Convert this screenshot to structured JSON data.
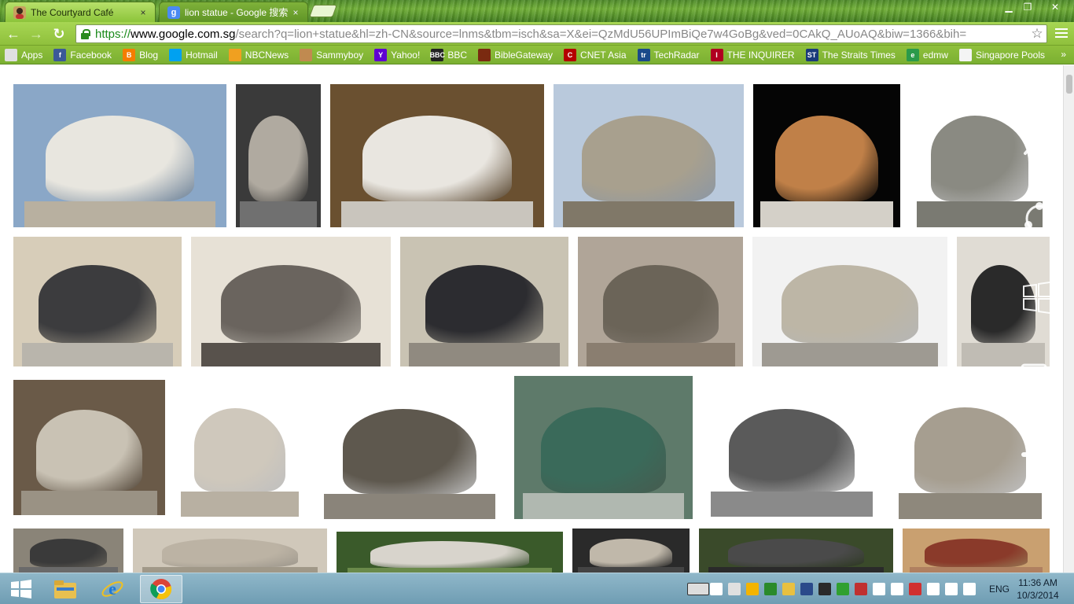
{
  "browser": {
    "tabs": [
      {
        "title": "The Courtyard Café",
        "active": true,
        "favicon": "avatar-icon",
        "close": "×"
      },
      {
        "title": "lion statue - Google 搜索",
        "active": false,
        "favicon": "google-icon",
        "favicon_text": "g",
        "close": "×"
      }
    ],
    "window_buttons": {
      "minimize": "▁",
      "maximize": "❐",
      "close": "✕"
    },
    "nav": {
      "back": "←",
      "forward": "→",
      "reload": "↻"
    },
    "url": {
      "scheme": "https://",
      "host": "www.google.com.sg",
      "rest": "/search?q=lion+statue&hl=zh-CN&source=lnms&tbm=isch&sa=X&ei=QzMdU56UPImBiQe7w4GoBg&ved=0CAkQ_AUoAQ&biw=1366&bih="
    },
    "star": "☆"
  },
  "bookmarks": [
    {
      "label": "Apps",
      "icon": "apps-grid-icon",
      "color": "#e0e0e0",
      "text": ""
    },
    {
      "label": "Facebook",
      "icon": "facebook-icon",
      "color": "#3b5998",
      "text": "f"
    },
    {
      "label": "Blog",
      "icon": "blogger-icon",
      "color": "#f57d00",
      "text": "B"
    },
    {
      "label": "Hotmail",
      "icon": "windows-flag-icon",
      "color": "#00a1f1",
      "text": ""
    },
    {
      "label": "NBCNews",
      "icon": "peacock-icon",
      "color": "#f0a020",
      "text": ""
    },
    {
      "label": "Sammyboy",
      "icon": "face-icon",
      "color": "#c08a50",
      "text": ""
    },
    {
      "label": "Yahoo!",
      "icon": "yahoo-icon",
      "color": "#5f01d1",
      "text": "Y"
    },
    {
      "label": "BBC",
      "icon": "bbc-icon",
      "color": "#222222",
      "text": "BBC"
    },
    {
      "label": "BibleGateway",
      "icon": "biblegateway-icon",
      "color": "#7a2a10",
      "text": ""
    },
    {
      "label": "CNET Asia",
      "icon": "cnet-icon",
      "color": "#b40000",
      "text": "C"
    },
    {
      "label": "TechRadar",
      "icon": "techradar-icon",
      "color": "#1a4a8a",
      "text": "tr"
    },
    {
      "label": "THE INQUIRER",
      "icon": "inquirer-icon",
      "color": "#b00020",
      "text": "I"
    },
    {
      "label": "The Straits Times",
      "icon": "straits-times-icon",
      "color": "#1a3a7a",
      "text": "ST"
    },
    {
      "label": "edmw",
      "icon": "edmw-icon",
      "color": "#2a9a4a",
      "text": "e"
    },
    {
      "label": "Singapore Pools",
      "icon": "page-icon",
      "color": "#f4f4f4",
      "text": ""
    }
  ],
  "bookmarks_overflow": "»",
  "images": [
    {
      "id": "r1c1",
      "sky": "#8aa7c7",
      "lion": "#e8e6df",
      "base": "#b8b0a0"
    },
    {
      "id": "r1c2",
      "sky": "#3a3a3a",
      "lion": "#b0aaa0",
      "base": "#707070"
    },
    {
      "id": "r1c3",
      "sky": "#6a5030",
      "lion": "#e9e6e0",
      "base": "#c9c5bd"
    },
    {
      "id": "r1c4",
      "sky": "#b9c9dc",
      "lion": "#a8a08e",
      "base": "#807868"
    },
    {
      "id": "r1c5",
      "sky": "#050505",
      "lion": "#c08048",
      "base": "#d4d0c8"
    },
    {
      "id": "r1c6",
      "sky": "#ffffff",
      "lion": "#8a8a82",
      "base": "#7a7a72"
    },
    {
      "id": "r2c1",
      "sky": "#d7cdb9",
      "lion": "#3c3c3e",
      "base": "#b9b5ac"
    },
    {
      "id": "r2c2",
      "sky": "#e7e1d6",
      "lion": "#6a645e",
      "base": "#58524c"
    },
    {
      "id": "r2c3",
      "sky": "#c9c3b3",
      "lion": "#2c2c30",
      "base": "#908a80"
    },
    {
      "id": "r2c4",
      "sky": "#b0a598",
      "lion": "#6b6458",
      "base": "#8a7e70"
    },
    {
      "id": "r2c5",
      "sky": "#f2f2f2",
      "lion": "#bdb6a6",
      "base": "#9e9a92"
    },
    {
      "id": "r2c6",
      "sky": "#e0dcd4",
      "lion": "#2a2a2a",
      "base": "#c0bcb4"
    },
    {
      "id": "r3c1",
      "sky": "#6a5a48",
      "lion": "#c9c2b4",
      "base": "#9a9284"
    },
    {
      "id": "r3c2",
      "sky": "#ffffff",
      "lion": "#cfc8bc",
      "base": "#b8b0a2"
    },
    {
      "id": "r3c3",
      "sky": "#ffffff",
      "lion": "#5e584e",
      "base": "#8a847a"
    },
    {
      "id": "r3c4",
      "sky": "#5e7a6a",
      "lion": "#3a6a5a",
      "base": "#b0b8b0"
    },
    {
      "id": "r3c5",
      "sky": "#ffffff",
      "lion": "#5a5a5a",
      "base": "#8a8a8a"
    },
    {
      "id": "r3c6",
      "sky": "#ffffff",
      "lion": "#a69e90",
      "base": "#8e887c"
    },
    {
      "id": "r4c1",
      "sky": "#8a8478",
      "lion": "#3a3a3a",
      "base": "#6a6a6a"
    },
    {
      "id": "r4c2",
      "sky": "#d0c8ba",
      "lion": "#bcb3a4",
      "base": "#a09888"
    },
    {
      "id": "r4c3",
      "sky": "#3a5a2a",
      "lion": "#d8d4cc",
      "base": "#6a8a4a"
    },
    {
      "id": "r4c4",
      "sky": "#2a2a2a",
      "lion": "#c0b8aa",
      "base": "#444444"
    },
    {
      "id": "r4c5",
      "sky": "#3a4a2a",
      "lion": "#4a4a4a",
      "base": "#2a2a2a"
    },
    {
      "id": "r4c6",
      "sky": "#c9a070",
      "lion": "#8a3a2a",
      "base": "#b08060"
    }
  ],
  "charms": [
    {
      "name": "search-charm",
      "icon": "magnifier-icon"
    },
    {
      "name": "share-charm",
      "icon": "share-icon"
    },
    {
      "name": "start-charm",
      "icon": "windows-logo-icon"
    },
    {
      "name": "devices-charm",
      "icon": "devices-icon"
    },
    {
      "name": "settings-charm",
      "icon": "gear-icon"
    }
  ],
  "taskbar": {
    "pinned": [
      {
        "name": "start-button",
        "icon": "windows-logo-icon"
      },
      {
        "name": "file-explorer",
        "icon": "folder-icon"
      },
      {
        "name": "internet-explorer",
        "icon": "ie-icon"
      },
      {
        "name": "chrome",
        "icon": "chrome-icon",
        "active": true
      }
    ],
    "tray_colors": [
      "#dddddd",
      "#ffffff",
      "#e0e0e0",
      "#f4b400",
      "#2a8a2a",
      "#e8c040",
      "#2a4a8a",
      "#2a2a2a",
      "#30a030",
      "#c03030",
      "#ffffff",
      "#ffffff",
      "#d03030",
      "#ffffff",
      "#ffffff",
      "#ffffff"
    ],
    "language": "ENG",
    "time": "11:36 AM",
    "date": "10/3/2014"
  }
}
